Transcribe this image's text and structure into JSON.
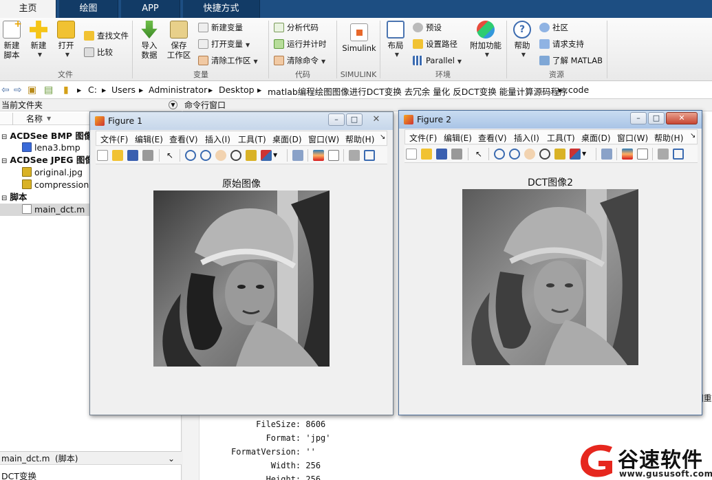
{
  "tabs": [
    {
      "label": "主页"
    },
    {
      "label": "绘图"
    },
    {
      "label": "APP"
    },
    {
      "label": "快捷方式"
    }
  ],
  "ribbon": {
    "file": {
      "title": "文件",
      "new_script": "新建\n脚本",
      "new": "新建",
      "open": "打开",
      "find_files": "查找文件",
      "compare": "比较"
    },
    "variable": {
      "title": "变量",
      "import": "导入\n数据",
      "save_ws": "保存\n工作区",
      "new_var": "新建变量",
      "open_var": "打开变量",
      "clear_ws": "清除工作区"
    },
    "code": {
      "title": "代码",
      "analyze": "分析代码",
      "run_time": "运行并计时",
      "clear_cmd": "清除命令"
    },
    "simulink": {
      "title": "SIMULINK",
      "label": "Simulink"
    },
    "env": {
      "title": "环境",
      "layout": "布局",
      "prefs": "预设",
      "set_path": "设置路径",
      "parallel": "Parallel",
      "addons": "附加功能"
    },
    "resources": {
      "title": "资源",
      "help": "帮助",
      "community": "社区",
      "support": "请求支持",
      "learn": "了解 MATLAB"
    }
  },
  "path": [
    "C:",
    "Users",
    "Administrator",
    "Desktop",
    "matlab编程绘图图像进行DCT变换 去冗余 量化 反DCT变换 能量计算源码程序",
    "code"
  ],
  "current_folder": {
    "title": "当前文件夹",
    "col_name": "名称",
    "items": [
      {
        "label": "ACDSee BMP 图像",
        "bold": true
      },
      {
        "label": "lena3.bmp"
      },
      {
        "label": "ACDSee JPEG 图像",
        "bold": true
      },
      {
        "label": "original.jpg"
      },
      {
        "label": "compression..."
      },
      {
        "label": "脚本",
        "bold": true
      },
      {
        "label": "main_dct.m"
      }
    ],
    "details_title": "main_dct.m  (脚本)",
    "details_body": "DCT变换"
  },
  "command_window": {
    "title": "命令行窗口",
    "lines": [
      "     FileSize: 8606",
      "       Format: 'jpg'",
      "FormatVersion: ''",
      "        Width: 256",
      "       Height: 256"
    ],
    "partial_right": "]重"
  },
  "figure_menu": [
    "文件(F)",
    "编辑(E)",
    "查看(V)",
    "插入(I)",
    "工具(T)",
    "桌面(D)",
    "窗口(W)",
    "帮助(H)"
  ],
  "figure1": {
    "title": "Figure 1",
    "plot_title": "原始图像"
  },
  "figure2": {
    "title": "Figure 2",
    "plot_title": "DCT图像2"
  },
  "watermark": {
    "brand": "谷速软件",
    "url": "www.gususoft.com"
  },
  "colors": {
    "tab_bg": "#123b66",
    "tab_active": "#f3f3f3",
    "accent_red": "#e6271e"
  }
}
